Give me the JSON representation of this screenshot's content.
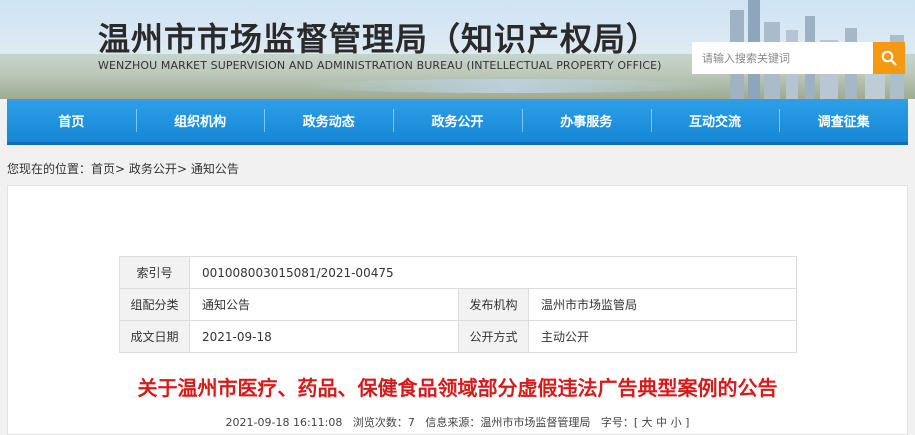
{
  "header": {
    "title_cn": "温州市市场监督管理局（知识产权局）",
    "title_en": "WENZHOU MARKET SUPERVISION AND ADMINISTRATION BUREAU (INTELLECTUAL PROPERTY OFFICE)",
    "search_placeholder": "请输入搜索关键词",
    "search_value": "",
    "accent_color": "#f39a15"
  },
  "nav": {
    "items": [
      "首页",
      "组织机构",
      "政务动态",
      "政务公开",
      "办事服务",
      "互动交流",
      "调查征集"
    ],
    "color": "#1a8fdc"
  },
  "breadcrumb": {
    "prefix": "您现在的位置：",
    "items": [
      "首页",
      "政务公开",
      "通知公告"
    ],
    "sep": ">"
  },
  "meta_table": {
    "index_label": "索引号",
    "index_value": "001008003015081/2021-00475",
    "category_label": "组配分类",
    "category_value": "通知公告",
    "publisher_label": "发布机构",
    "publisher_value": "温州市市场监管局",
    "date_label": "成文日期",
    "date_value": "2021-09-18",
    "disclosure_label": "公开方式",
    "disclosure_value": "主动公开"
  },
  "article": {
    "title": "关于温州市医疗、药品、保健食品领域部分虚假违法广告典型案例的公告",
    "title_color": "#d71a1a",
    "date": "2021-09-18 16:11:08",
    "views_label": "浏览次数：",
    "views": "7",
    "source_label": "信息来源：",
    "source": "温州市市场监督管理局",
    "font_label": "字号：",
    "font_sizes": [
      "大",
      "中",
      "小"
    ]
  }
}
